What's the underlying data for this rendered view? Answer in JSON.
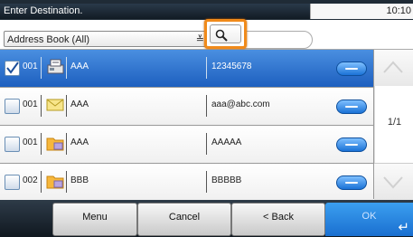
{
  "header": {
    "title": "Enter Destination.",
    "time": "10:10"
  },
  "filter": {
    "address_book": "Address Book (All)",
    "search_value": ""
  },
  "rows": [
    {
      "number": "001",
      "type": "fax",
      "name": "AAA",
      "destination": "12345678",
      "selected": true
    },
    {
      "number": "001",
      "type": "email",
      "name": "AAA",
      "destination": "aaa@abc.com",
      "selected": false
    },
    {
      "number": "001",
      "type": "folder",
      "name": "AAA",
      "destination": "AAAAA",
      "selected": false
    },
    {
      "number": "002",
      "type": "folder",
      "name": "BBB",
      "destination": "BBBBB",
      "selected": false
    }
  ],
  "pager": {
    "page": "1/1"
  },
  "footer": {
    "menu": "Menu",
    "cancel": "Cancel",
    "back": "< Back",
    "ok": "OK"
  },
  "colors": {
    "selected_row": "#2a6fcc",
    "highlight": "#f08a1a",
    "ok_button": "#2a8ae6"
  }
}
